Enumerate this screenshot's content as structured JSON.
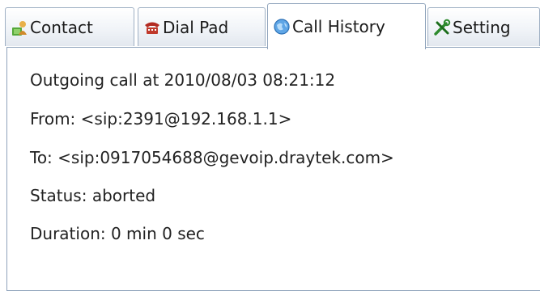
{
  "tabs": [
    {
      "label": "Contact",
      "icon": "contact-icon"
    },
    {
      "label": "Dial Pad",
      "icon": "phone-icon"
    },
    {
      "label": "Call History",
      "icon": "globe-icon"
    },
    {
      "label": "Setting",
      "icon": "tools-icon"
    }
  ],
  "active_tab": "Call History",
  "history": {
    "title_line": "Outgoing call at 2010/08/03 08:21:12",
    "from_line": "From: <sip:2391@192.168.1.1>",
    "to_line": "To: <sip:0917054688@gevoip.draytek.com>",
    "status_line": "Status: aborted",
    "duration_line": "Duration: 0 min 0 sec"
  }
}
